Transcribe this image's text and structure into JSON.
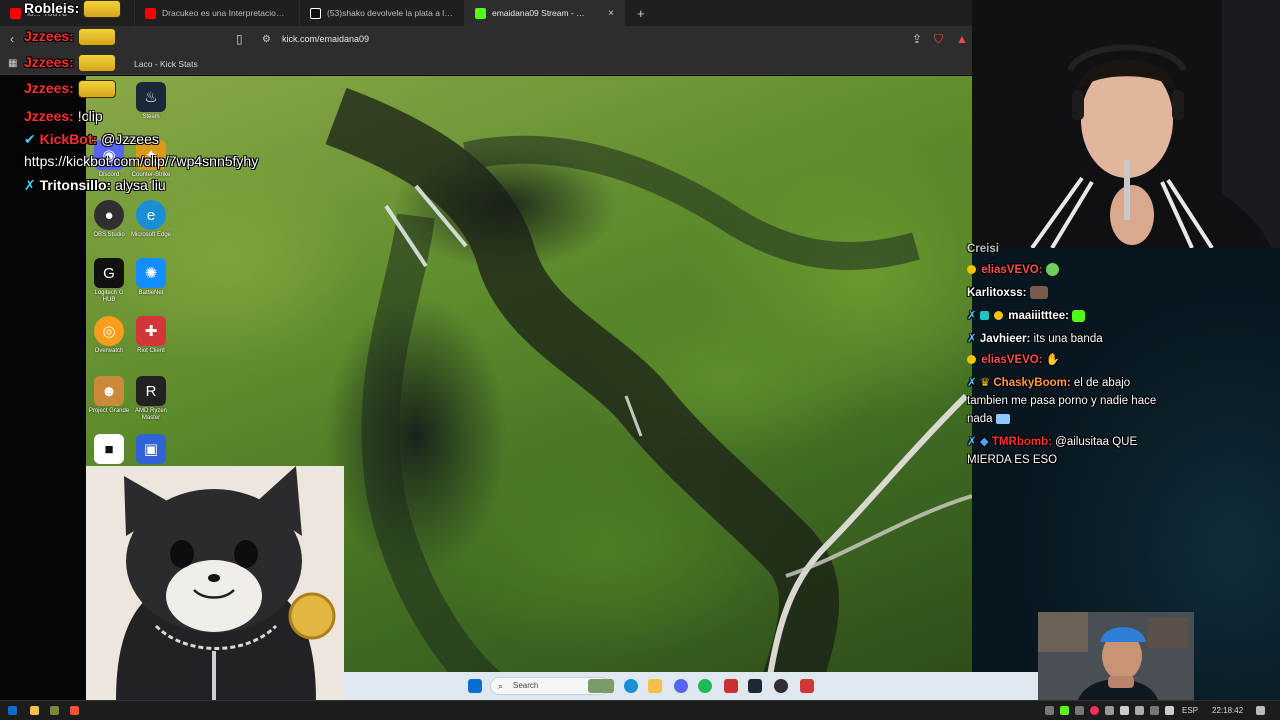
{
  "browser": {
    "tabs": [
      {
        "label": "lo... YouTu",
        "color": "#ff0000"
      },
      {
        "label": "Dracukeo es una Interpretacion !!! - Y",
        "color": "#ff0000"
      },
      {
        "label": "(53)shako devolvele la plata a los pib",
        "color": "#ffffff"
      },
      {
        "label": "emaidana09 Stream - Watch",
        "color": "#53fc18",
        "active": true
      }
    ],
    "new_tab_glyph": "+",
    "close_glyph": "×",
    "url": "kick.com/emaidana09",
    "bookmark": "Laco - Kick Stats"
  },
  "chat_left": [
    {
      "user": "Robleis:",
      "color": "#ffffff",
      "message": "",
      "emote": true
    },
    {
      "user": "Jzzees:",
      "color": "#ff2d2d",
      "message": "",
      "emote": true
    },
    {
      "user": "Jzzees:",
      "color": "#ff2d2d",
      "message": "",
      "emote": true
    },
    {
      "user": "Jzzees:",
      "color": "#ff2d2d",
      "message": "",
      "emote": true
    },
    {
      "user": "Jzzees:",
      "color": "#ff2d2d",
      "message": "!clip",
      "emote": false
    },
    {
      "user": "KickBot:",
      "color": "#ff2d2d",
      "message": "@Jzzees",
      "emote": false
    },
    {
      "user": "",
      "color": "#ffffff",
      "message": "https://kickbot.com/clip/7wp4snn5fyhy",
      "emote": false
    },
    {
      "user": "Tritonsillo:",
      "color": "#ffffff",
      "message": "alysa liu",
      "emote": false
    }
  ],
  "chat_right": [
    {
      "user": "Creisi",
      "color": "#ffffff",
      "message": ""
    },
    {
      "user": "eliasVEVO:",
      "color": "#ff4d4d",
      "message": ""
    },
    {
      "user": "Karlitoxss:",
      "color": "#ffffff",
      "message": ""
    },
    {
      "user": "maaiiitttee:",
      "color": "#ffffff",
      "message": ""
    },
    {
      "user": "Javhieer:",
      "color": "#ffffff",
      "message": "its una banda"
    },
    {
      "user": "eliasVEVO:",
      "color": "#ff4d4d",
      "message": ""
    },
    {
      "user": "ChaskyBoom:",
      "color": "#ff9a3d",
      "message": "el de abajo"
    },
    {
      "user": "",
      "color": "#ffffff",
      "message": "tambien me pasa porno y nadie hace"
    },
    {
      "user": "",
      "color": "#ffffff",
      "message": "nada"
    },
    {
      "user": "TMRbomb:",
      "color": "#ff2d2d",
      "message": "@ailusitaa QUE"
    },
    {
      "user": "",
      "color": "#ffffff",
      "message": "MIERDA ES ESO"
    }
  ],
  "desktop_icons": [
    {
      "label": "Steam",
      "glyph": "♨",
      "color": "#1b2838"
    },
    {
      "label": "Discord",
      "glyph": "◉",
      "color": "#5865f2"
    },
    {
      "label": "Counter-Strike 2",
      "glyph": "✦",
      "color": "#d89a1b"
    },
    {
      "label": "OBS Studio",
      "glyph": "●",
      "color": "#302e31"
    },
    {
      "label": "Microsoft Edge",
      "glyph": "e",
      "color": "#1a8fd6"
    },
    {
      "label": "Logitech G HUB",
      "glyph": "G",
      "color": "#111111"
    },
    {
      "label": "BattleNet",
      "glyph": "✺",
      "color": "#148eff"
    },
    {
      "label": "Overwatch",
      "glyph": "◎",
      "color": "#f99e1a"
    },
    {
      "label": "Riot Client",
      "glyph": "✚",
      "color": "#d13639"
    },
    {
      "label": "Project Grande",
      "glyph": "☻",
      "color": "#c98a3a"
    },
    {
      "label": "AMD Ryzen Master",
      "glyph": "R",
      "color": "#222222"
    },
    {
      "label": "Roblox",
      "glyph": "■",
      "color": "#ffffff"
    },
    {
      "label": "",
      "glyph": "▣",
      "color": "#2f63d6"
    }
  ],
  "inner_taskbar": {
    "search_placeholder": "Search"
  },
  "system_tray": {
    "lang": "ESP",
    "time": "22:18:42"
  },
  "colors": {
    "kick_green": "#53fc18",
    "chrome_bg": "#2d2d2d"
  }
}
